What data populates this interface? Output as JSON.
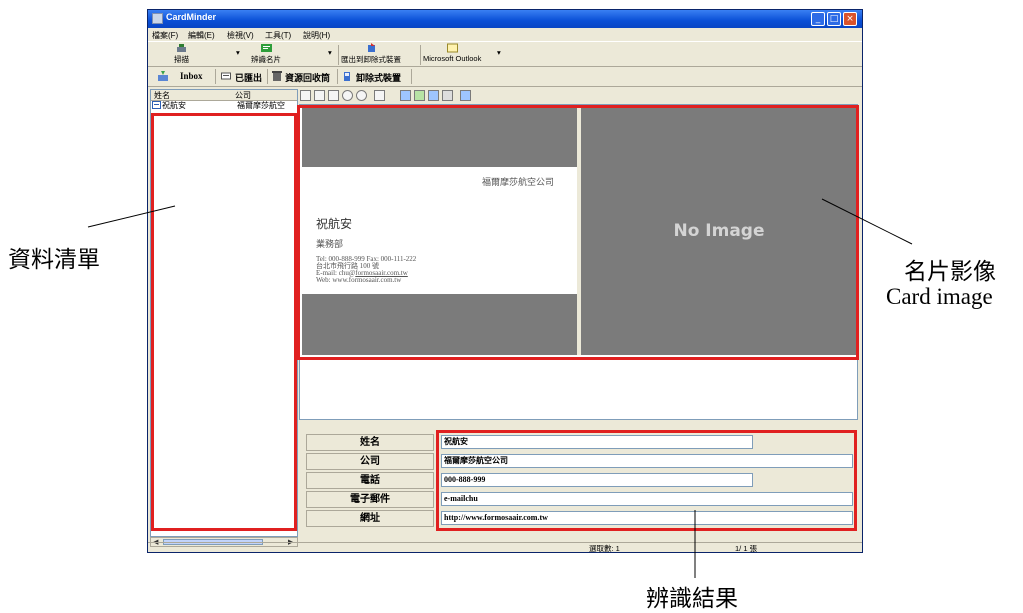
{
  "window": {
    "title": "CardMinder",
    "controls": [
      "_",
      "□",
      "×"
    ]
  },
  "menu": [
    "檔案(F)",
    "編輯(E)",
    "檢視(V)",
    "工具(T)",
    "說明(H)"
  ],
  "toolbar1": {
    "scan_label": "掃描",
    "recognize_label": "辨識名片",
    "export_label": "匯出到卸除式裝置",
    "outlook_label": "Microsoft Outlook",
    "dropdown_glyph": "▾"
  },
  "toolbar2": {
    "inbox_label": "Inbox",
    "exported_label": "已匯出",
    "recycle_label": "資源回收筒",
    "removable_label": "卸除式裝置"
  },
  "list": {
    "columns": [
      "姓名",
      "公司"
    ],
    "rows": [
      {
        "name": "祝航安",
        "company": "福爾摩莎航空"
      }
    ]
  },
  "card": {
    "company": "福爾摩莎航空公司",
    "name": "祝航安",
    "department": "業務部",
    "tel_line": "Tel: 000-888-999    Fax: 000-111-222",
    "address": "台北市飛行路 100 號",
    "email_prefix": "E-mail: chu@",
    "email_link": "formosaair.com.tw",
    "web": "Web: www.formosaair.com.tw"
  },
  "back_image_text": "No Image",
  "fields": [
    {
      "label": "姓名",
      "value": "祝航安"
    },
    {
      "label": "公司",
      "value": "福爾摩莎航空公司"
    },
    {
      "label": "電話",
      "value": "000-888-999"
    },
    {
      "label": "電子郵件",
      "value": "e-mailchu"
    },
    {
      "label": "網址",
      "value": "http://www.formosaair.com.tw"
    }
  ],
  "status": {
    "selected": "選取數:  1",
    "page": "1/   1 張"
  },
  "callouts": {
    "list": "資料清單",
    "card_image_zh": "名片影像",
    "card_image_en": "Card image",
    "recognition": "辨識結果"
  },
  "colors": {
    "annotation_red": "#e02020",
    "title_blue": "#0a4fd6",
    "image_gray": "#7b7b7b"
  }
}
